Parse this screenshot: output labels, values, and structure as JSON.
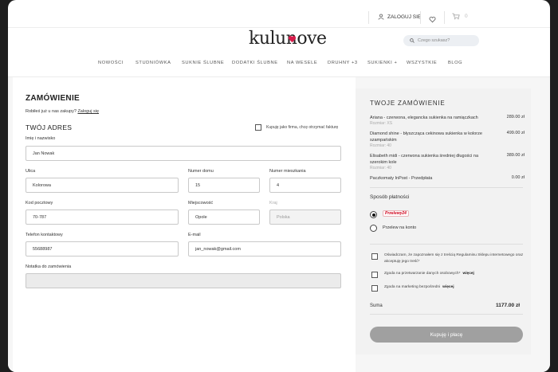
{
  "header": {
    "login_label": "ZALOGUJ SIĘ",
    "cart_count": "0",
    "logo_text": "kulunove",
    "search_placeholder": "Czego szukasz?"
  },
  "nav": [
    "NOWOŚCI",
    "STUDNIÓWKA",
    "SUKNIE ŚLUBNE",
    "DODATKI ŚLUBNE",
    "NA WESELE",
    "DRUHNY +3",
    "SUKIENKI +",
    "WSZYSTKIE",
    "BLOG"
  ],
  "form": {
    "title": "ZAMÓWIENIE",
    "question": "Robiłeś już u nas zakupy?",
    "login_link": "Zaloguj się",
    "address_title": "TWÓJ ADRES",
    "company_checkbox": "Kupuję jako firma, chcę otrzymać fakturę",
    "fields": {
      "name": {
        "label": "Imię i nazwisko",
        "value": "Jan Nowak"
      },
      "street": {
        "label": "Ulica",
        "value": "Kolorowa"
      },
      "house": {
        "label": "Numer domu",
        "value": "15"
      },
      "flat": {
        "label": "Numer mieszkania",
        "value": "4"
      },
      "postal": {
        "label": "Kod pocztowy",
        "value": "70-787"
      },
      "city": {
        "label": "Miejscowość",
        "value": "Opole"
      },
      "country": {
        "label": "Kraj",
        "value": "Polska"
      },
      "phone": {
        "label": "Telefon kontaktowy",
        "value": "55688987"
      },
      "email": {
        "label": "E-mail",
        "value": "jan_nowak@gmail.com"
      },
      "note": {
        "label": "Notatka do zamówienia",
        "value": ""
      }
    }
  },
  "summary": {
    "title": "TWOJE ZAMÓWIENIE",
    "items": [
      {
        "name": "Ariana - czerwona, elegancka sukienka na ramiączkach",
        "size": "Rozmiar: XS",
        "price": "289.00 zł"
      },
      {
        "name": "Diamond shine - błyszcząca cekinowa sukienka w kolorze szampańskim",
        "size": "Rozmiar: 40",
        "price": "499.00 zł"
      },
      {
        "name": "Elisabeth midi - czerwona sukienka średniej długości na szerokim kole",
        "size": "Rozmiar: 40",
        "price": "389.00 zł"
      }
    ],
    "shipping": {
      "name": "Paczkomaty InPost - Przedpłata",
      "price": "0.00 zł"
    },
    "payment_title": "Sposób płatności",
    "payment_options": [
      {
        "label": "Przelewy24",
        "selected": true
      },
      {
        "label": "Przelew na konto",
        "selected": false
      }
    ],
    "consents": [
      {
        "text": "Oświadczam, że zapoznałem się z treścią Regulaminu Sklepu internetowego oraz akceptuję jego treść*",
        "more": ""
      },
      {
        "text": "Zgoda na przetwarzanie danych osobowych*",
        "more": "więcej"
      },
      {
        "text": "Zgoda na marketing bezpośredni",
        "more": "więcej"
      }
    ],
    "total_label": "Suma",
    "total_value": "1177.00 zł",
    "buy_button": "Kupuję i płacę"
  },
  "colors": {
    "accent_heart": "#d81b4a",
    "button_disabled": "#a0a0a0"
  }
}
